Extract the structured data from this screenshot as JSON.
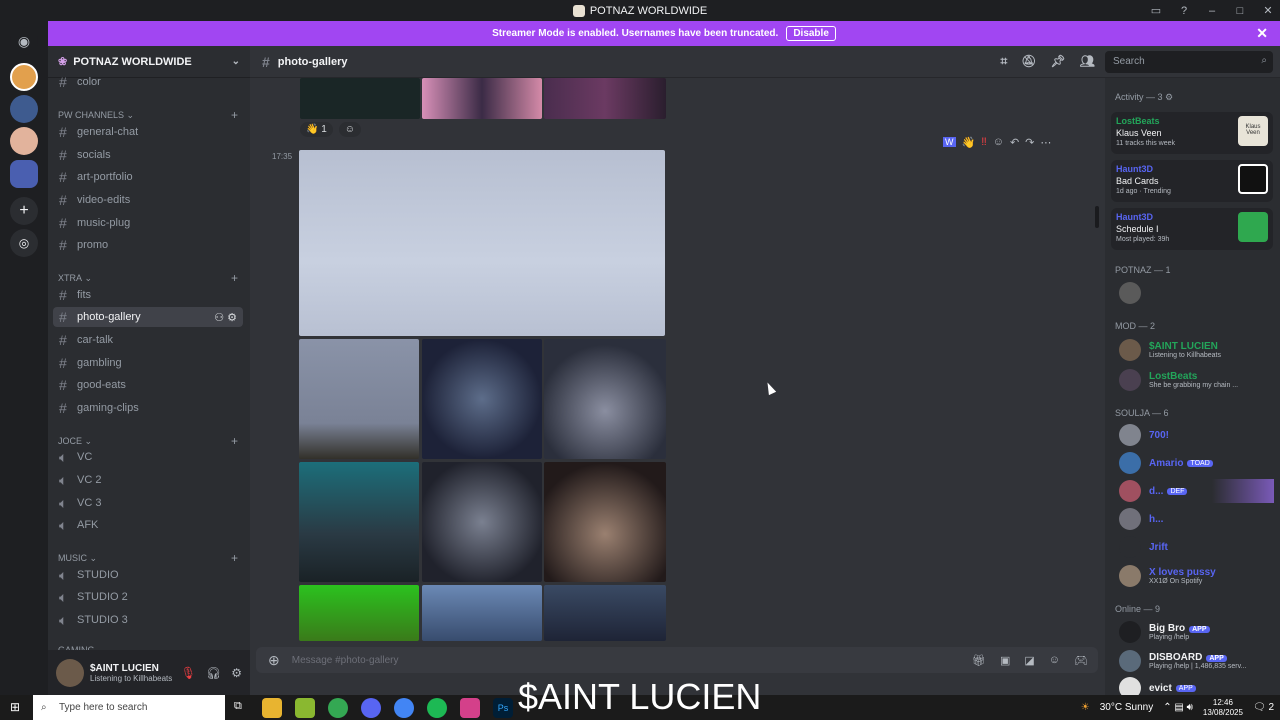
{
  "window": {
    "title": "POTNAZ WORLDWIDE"
  },
  "banner": {
    "text": "Streamer Mode is enabled. Usernames have been truncated.",
    "button": "Disable"
  },
  "server": {
    "name": "POTNAZ WORLDWIDE"
  },
  "sidebar": {
    "top_channel": "color",
    "pw_channels": {
      "label": "PW CHANNELS",
      "items": [
        "general-chat",
        "socials",
        "art-portfolio",
        "video-edits",
        "music-plug",
        "promo"
      ]
    },
    "xtra": {
      "label": "XTRA",
      "items": [
        "fits",
        "photo-gallery",
        "car-talk",
        "gambling",
        "good-eats",
        "gaming-clips"
      ]
    },
    "joce": {
      "label": "JOCE",
      "items": [
        "VC",
        "VC 2",
        "VC 3",
        "AFK"
      ]
    },
    "music": {
      "label": "MUSIC",
      "items": [
        "STUDIO",
        "STUDIO 2",
        "STUDIO 3"
      ]
    },
    "gaming": {
      "label": "GAMING"
    }
  },
  "user": {
    "name": "$AINT LUCIEN",
    "status": "Listening to Killhabeats"
  },
  "channel": {
    "name": "photo-gallery"
  },
  "search": {
    "placeholder": "Search"
  },
  "message": {
    "time": "17:35",
    "reaction_count": "1",
    "reaction_emoji": "👋"
  },
  "composer": {
    "placeholder": "Message #photo-gallery"
  },
  "members": {
    "activity": {
      "label": "Activity — 3",
      "cards": [
        {
          "name": "LostBeats",
          "title": "Klaus Veen",
          "sub": "11 tracks this week",
          "thumb_text": "Klaus Veen"
        },
        {
          "name": "Haunt3D",
          "title": "Bad Cards",
          "sub1": "1d ago",
          "sub2": "Trending"
        },
        {
          "name": "Haunt3D",
          "title": "Schedule I",
          "sub": "Most played: 39h"
        }
      ]
    },
    "potnaz": {
      "label": "POTNAZ — 1"
    },
    "mod": {
      "label": "MOD — 2",
      "items": [
        {
          "name": "$AINT LUCIEN",
          "sub": "Listening to Killhabeats"
        },
        {
          "name": "LostBeats",
          "sub": "She be grabbing my chain ..."
        }
      ]
    },
    "soulja": {
      "label": "SOULJA — 6",
      "items": [
        {
          "name": "700!"
        },
        {
          "name": "Amario",
          "tag": "TOAD"
        },
        {
          "name": "d...",
          "tag": "DEF"
        },
        {
          "name": "h..."
        },
        {
          "name": "Jrift"
        },
        {
          "name": "X loves pussy",
          "sub": "XX1Ø On Spotify"
        }
      ]
    },
    "online": {
      "label": "Online — 9",
      "items": [
        {
          "name": "Big Bro",
          "tag": "APP",
          "sub": "Playing /help"
        },
        {
          "name": "DISBOARD",
          "tag": "APP",
          "sub": "Playing /help | 1,486,835 serv..."
        },
        {
          "name": "evict",
          "tag": "APP"
        }
      ]
    }
  },
  "overlay_text": "$AINT LUCIEN",
  "taskbar": {
    "search_placeholder": "Type here to search",
    "weather": "30°C  Sunny",
    "time": "12:46",
    "date": "13/08/2025",
    "notif_count": "2"
  }
}
